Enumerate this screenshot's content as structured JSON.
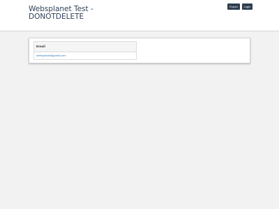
{
  "header": {
    "title": "Websplanet Test - DONOTDELETE",
    "export_label": "Export",
    "login_label": "Login"
  },
  "table": {
    "columns": [
      "Email"
    ],
    "rows": [
      [
        "websplanet@gmail.com"
      ]
    ]
  },
  "colors": {
    "header_bg": "#ffffff",
    "page_bg": "#f2f2f2",
    "button_bg": "#2e3e4f",
    "title_text": "#2f4055",
    "link_text": "#3a7bbf"
  }
}
